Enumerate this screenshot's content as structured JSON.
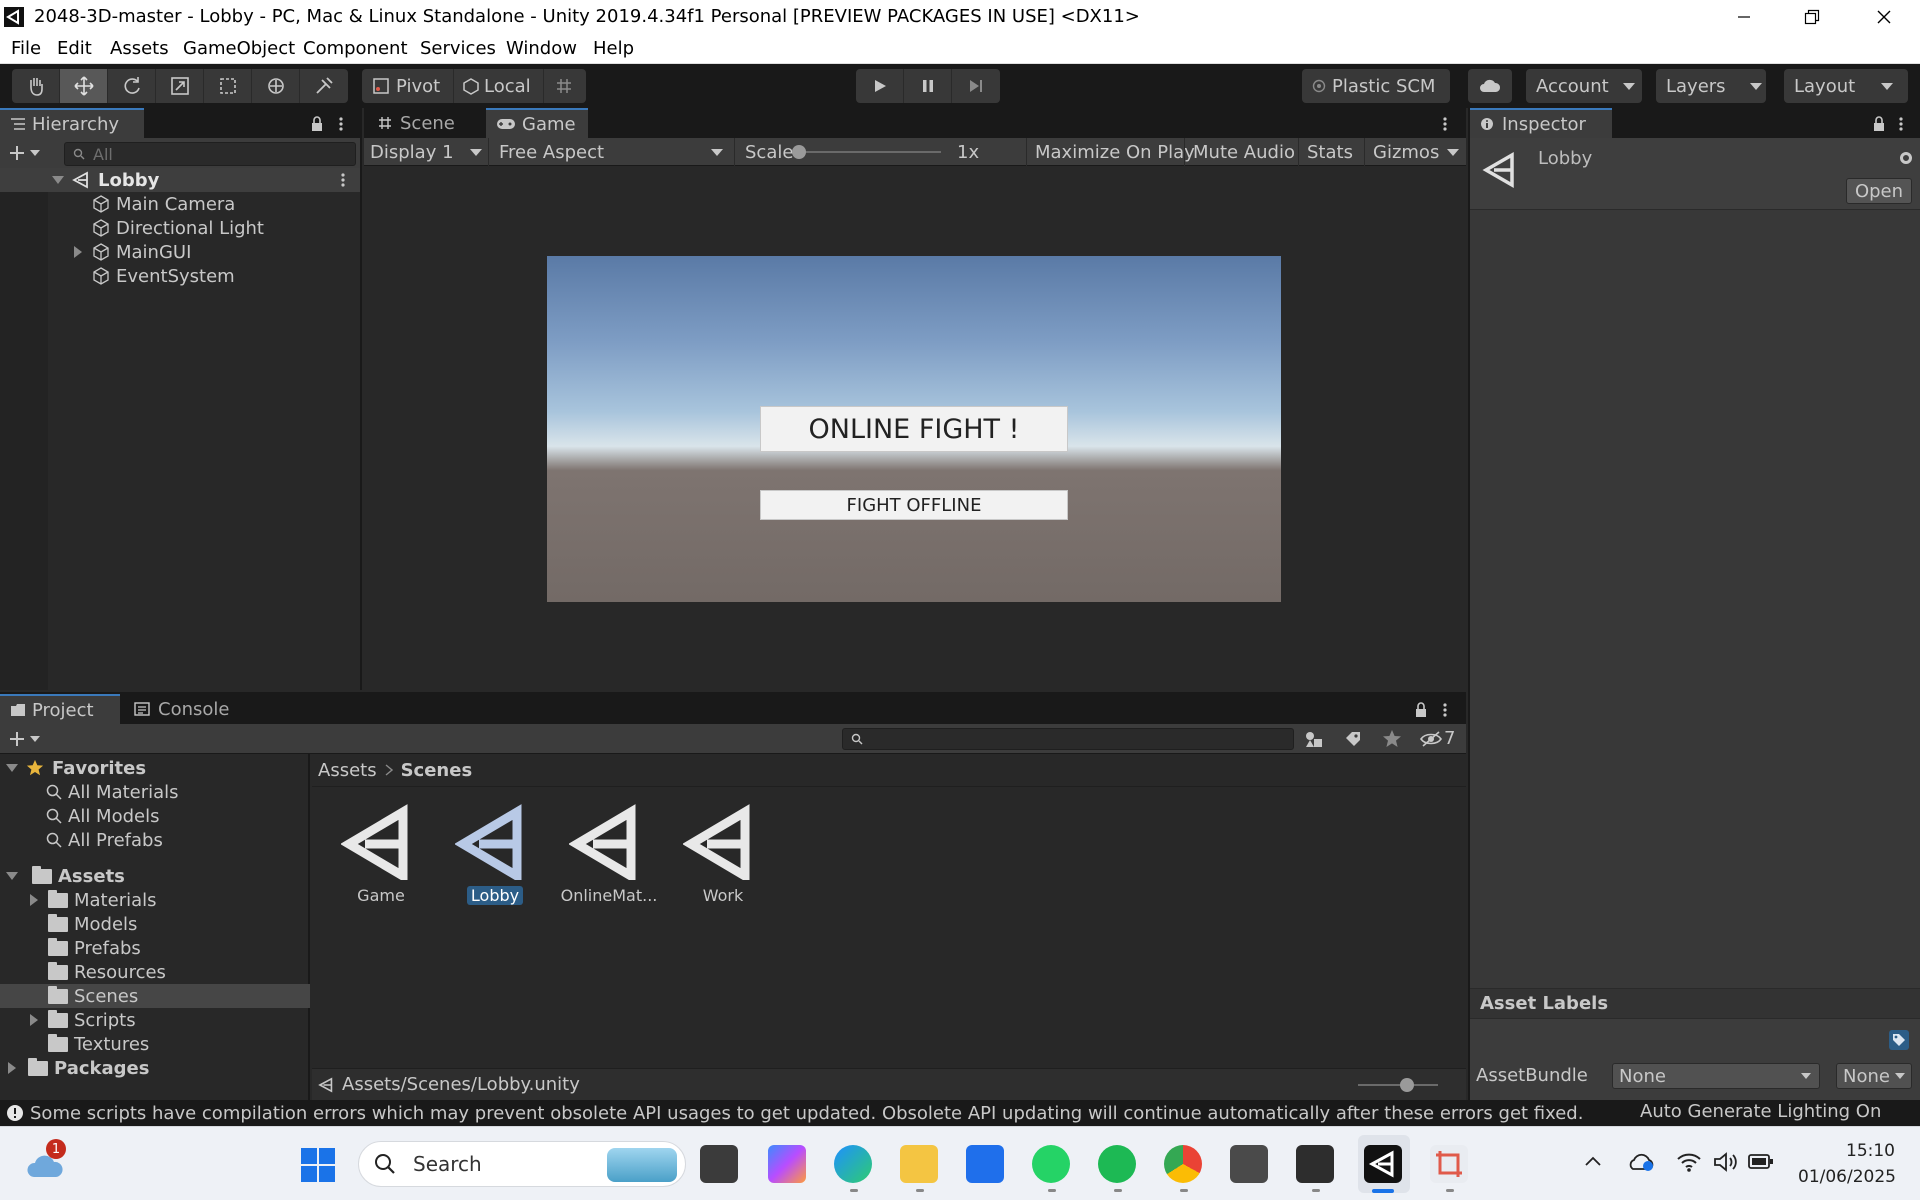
{
  "window": {
    "title": "2048-3D-master - Lobby - PC, Mac & Linux Standalone - Unity 2019.4.34f1 Personal [PREVIEW PACKAGES IN USE] <DX11>"
  },
  "menu": [
    "File",
    "Edit",
    "Assets",
    "GameObject",
    "Component",
    "Services",
    "Window",
    "Help"
  ],
  "toolbar": {
    "pivot_label": "Pivot",
    "local_label": "Local",
    "plastic_label": "Plastic SCM",
    "account_label": "Account",
    "layers_label": "Layers",
    "layout_label": "Layout"
  },
  "hierarchy": {
    "tab_label": "Hierarchy",
    "search_placeholder": "All",
    "scene_name": "Lobby",
    "items": [
      "Main Camera",
      "Directional Light",
      "MainGUI",
      "EventSystem"
    ]
  },
  "game_view": {
    "scene_tab": "Scene",
    "game_tab": "Game",
    "display": "Display 1",
    "aspect": "Free Aspect",
    "scale_label": "Scale",
    "scale_value": "1x",
    "scale_slider_level": 0,
    "maximize_label": "Maximize On Play",
    "mute_label": "Mute Audio",
    "stats_label": "Stats",
    "gizmos_label": "Gizmos",
    "online_button": "ONLINE FIGHT !",
    "offline_button": "FIGHT OFFLINE"
  },
  "inspector": {
    "tab_label": "Inspector",
    "asset_name": "Lobby",
    "open_label": "Open",
    "asset_labels_title": "Asset Labels",
    "assetbundle_label": "AssetBundle",
    "assetbundle_value": "None",
    "variant_value": "None"
  },
  "project": {
    "project_tab": "Project",
    "console_tab": "Console",
    "hidden_count": "7",
    "favorites_label": "Favorites",
    "favorites": [
      "All Materials",
      "All Models",
      "All Prefabs"
    ],
    "assets_label": "Assets",
    "asset_folders": [
      "Materials",
      "Models",
      "Prefabs",
      "Resources",
      "Scenes",
      "Scripts",
      "Textures"
    ],
    "packages_label": "Packages",
    "breadcrumb_root": "Assets",
    "breadcrumb_current": "Scenes",
    "scene_assets": [
      "Game",
      "Lobby",
      "OnlineMat...",
      "Work"
    ],
    "selected_path": "Assets/Scenes/Lobby.unity"
  },
  "status": {
    "message": "Some scripts have compilation errors which may prevent obsolete API usages to get updated. Obsolete API updating will continue automatically after these errors get fixed.",
    "lighting": "Auto Generate Lighting On"
  },
  "taskbar": {
    "search_label": "Search",
    "notification_count": "1",
    "time": "15:10",
    "date": "01/06/2025"
  },
  "colors": {
    "accent": "#3a79bb",
    "selection": "#2c5d87",
    "editor_bg": "#282828"
  }
}
